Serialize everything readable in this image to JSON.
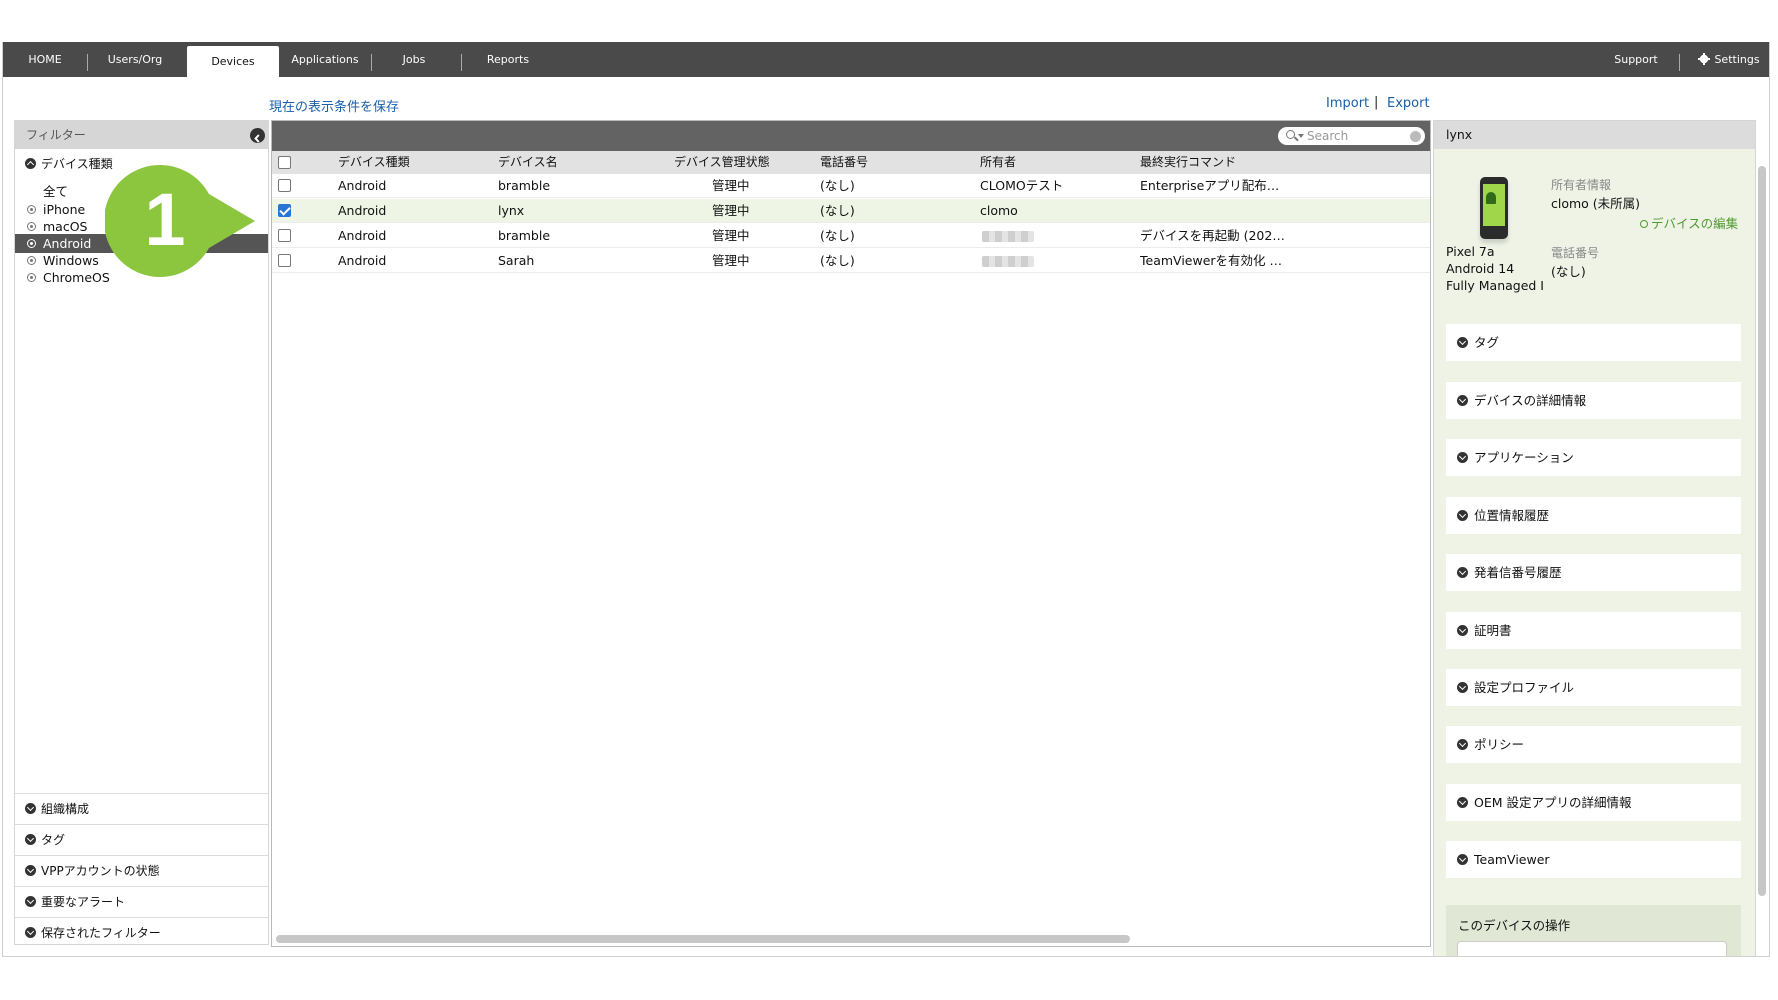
{
  "nav": {
    "items": [
      {
        "label": "HOME"
      },
      {
        "label": "Users/Org"
      },
      {
        "label": "Devices"
      },
      {
        "label": "Applications"
      },
      {
        "label": "Jobs"
      },
      {
        "label": "Reports"
      }
    ],
    "support": "Support",
    "settings": "Settings"
  },
  "actions": {
    "save_view": "現在の表示条件を保存",
    "import": "Import",
    "separator": "|",
    "export": "Export"
  },
  "filter_panel": {
    "title": "フィルター",
    "device_type_section": "デバイス種類",
    "options": [
      "全て",
      "iPhone",
      "macOS",
      "Android",
      "Windows",
      "ChromeOS"
    ],
    "selected_option": "Android",
    "sections": [
      "組織構成",
      "タグ",
      "VPPアカウントの状態",
      "重要なアラート",
      "保存されたフィルター"
    ]
  },
  "table": {
    "search_placeholder": "Search",
    "columns": [
      "デバイス種類",
      "デバイス名",
      "デバイス管理状態",
      "電話番号",
      "所有者",
      "最終実行コマンド"
    ],
    "rows": [
      {
        "type": "Android",
        "name": "bramble",
        "status": "管理中",
        "phone": "(なし)",
        "owner": "CLOMOテスト",
        "last_command": "Enterpriseアプリ配布…",
        "checked": false,
        "owner_blurred": false
      },
      {
        "type": "Android",
        "name": "lynx",
        "status": "管理中",
        "phone": "(なし)",
        "owner": "clomo",
        "last_command": "",
        "checked": true,
        "owner_blurred": false
      },
      {
        "type": "Android",
        "name": "bramble",
        "status": "管理中",
        "phone": "(なし)",
        "owner": "",
        "last_command": "デバイスを再起動 (202…",
        "checked": false,
        "owner_blurred": true
      },
      {
        "type": "Android",
        "name": "Sarah",
        "status": "管理中",
        "phone": "(なし)",
        "owner": "",
        "last_command": "TeamViewerを有効化 …",
        "checked": false,
        "owner_blurred": true
      }
    ]
  },
  "detail": {
    "header": "lynx",
    "owner_label": "所有者情報",
    "owner_value": "clomo (未所属)",
    "edit_link": "デバイスの編集",
    "phone_label": "電話番号",
    "phone_value": "(なし)",
    "model": "Pixel 7a",
    "os": "Android 14",
    "mode": "Fully Managed I",
    "sections": [
      "タグ",
      "デバイスの詳細情報",
      "アプリケーション",
      "位置情報履歴",
      "発着信番号履歴",
      "証明書",
      "設定プロファイル",
      "ポリシー",
      "OEM 設定アプリの詳細情報",
      "TeamViewer"
    ],
    "ops_title": "このデバイスの操作"
  },
  "callout": {
    "number": "1",
    "color": "#8cc63f"
  },
  "colors": {
    "nav_bg": "#4a4a4a",
    "link": "#1a5fa8",
    "accent_green": "#4f9a2f",
    "selected_row": "#eef5e4"
  }
}
